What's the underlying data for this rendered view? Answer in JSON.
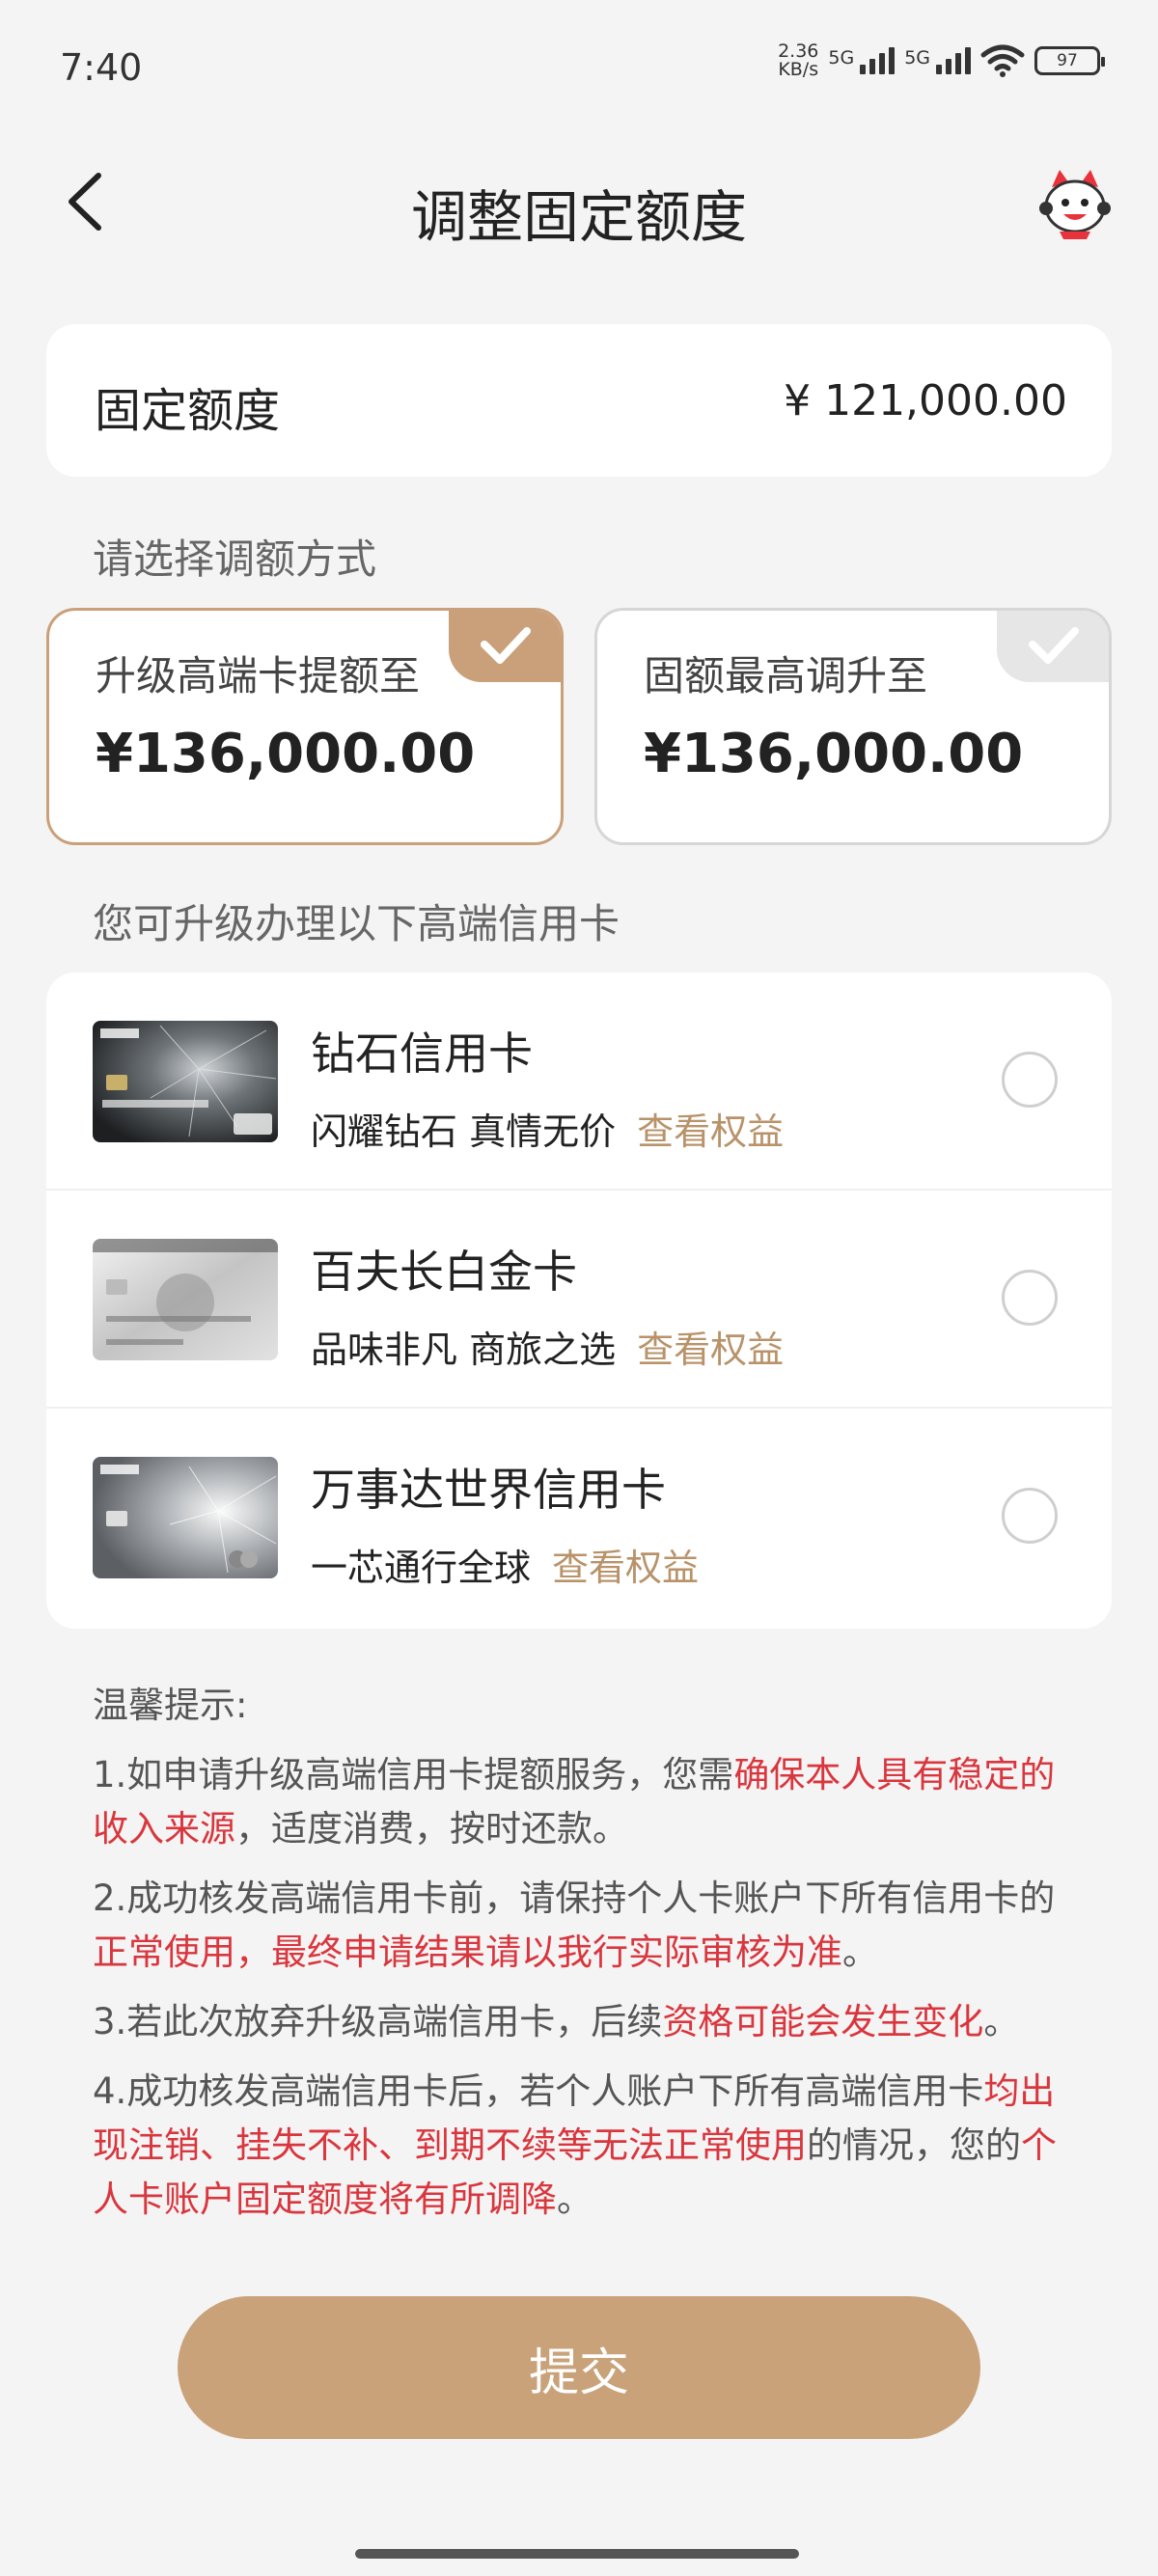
{
  "status_bar": {
    "time": "7:40",
    "net_speed_value": "2.36",
    "net_speed_unit": "KB/s",
    "signal1_label": "5G",
    "signal2_label": "5G",
    "battery": "97",
    "icons": [
      "signal-icon",
      "signal-icon",
      "wifi-icon",
      "battery-icon"
    ]
  },
  "header": {
    "title": "调整固定额度",
    "back_icon": "back-arrow-icon",
    "mascot_icon": "mascot-icon"
  },
  "fixed_limit": {
    "label": "固定额度",
    "value": "¥ 121,000.00"
  },
  "adjust_section": {
    "label": "请选择调额方式",
    "options": [
      {
        "title": "升级高端卡提额至",
        "amount": "¥136,000.00",
        "selected": true
      },
      {
        "title": "固额最高调升至",
        "amount": "¥136,000.00",
        "selected": false
      }
    ]
  },
  "cards_section": {
    "label": "您可升级办理以下高端信用卡",
    "cards": [
      {
        "name": "钻石信用卡",
        "desc": "闪耀钻石  真情无价",
        "link": "查看权益",
        "selected": false
      },
      {
        "name": "百夫长白金卡",
        "desc": "品味非凡  商旅之选",
        "link": "查看权益",
        "selected": false
      },
      {
        "name": "万事达世界信用卡",
        "desc": "一芯通行全球",
        "link": "查看权益",
        "selected": false
      }
    ]
  },
  "tips": {
    "title": "温馨提示:",
    "t1_a": "1.如申请升级高端信用卡提额服务，您需",
    "t1_b": "确保本人具有稳定的收入来源",
    "t1_c": "，适度消费，按时还款。",
    "t2_a": "2.成功核发高端信用卡前，请保持个人卡账户下所有信用卡的",
    "t2_b": "正常使用，最终申请结果请以我行实际审核为准",
    "t2_c": "。",
    "t3_a": "3.若此次放弃升级高端信用卡，后续",
    "t3_b": "资格可能会发生变化",
    "t3_c": "。",
    "t4_a": "4.成功核发高端信用卡后，若个人账户下所有高端信用卡",
    "t4_b": "均出现注销、挂失不补、到期不续等无法正常使用",
    "t4_c": "的情况，您的",
    "t4_d": "个人卡账户固定额度将有所调降",
    "t4_e": "。"
  },
  "submit_label": "提交",
  "colors": {
    "accent": "#c9a07a",
    "link": "#b8936a",
    "warning_red": "#d9363e",
    "background": "#f4f4f4"
  }
}
